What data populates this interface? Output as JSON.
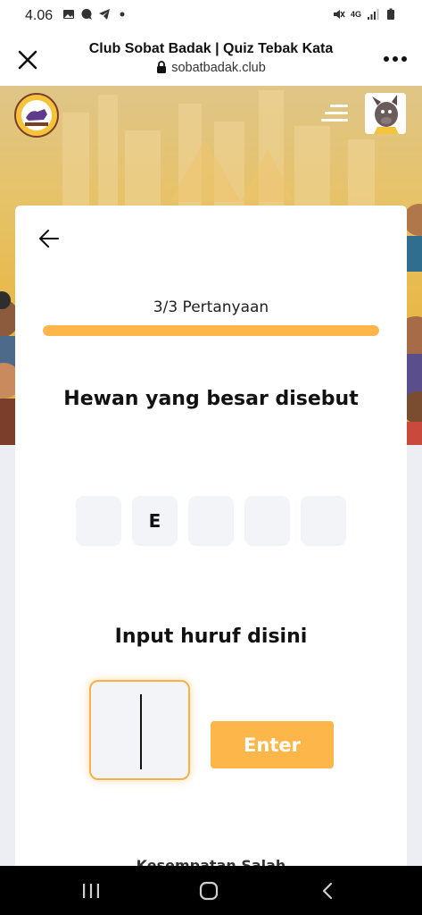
{
  "status_bar": {
    "time": "4.06",
    "network": "4G",
    "icons_left": [
      "image-icon",
      "chat-bubble-icon",
      "telegram-icon",
      "dot-icon"
    ],
    "icons_right": [
      "mute-icon",
      "network-4g-icon",
      "signal-icon",
      "battery-icon"
    ]
  },
  "browser": {
    "title": "Club Sobat Badak | Quiz Tebak Kata",
    "url": "sobatbadak.club"
  },
  "quiz": {
    "progress_label": "3/3 Pertanyaan",
    "progress_fraction": 1.0,
    "question": "Hewan yang besar disebut",
    "slots": [
      "",
      "E",
      "",
      "",
      ""
    ],
    "input_label": "Input huruf disini",
    "input_value": "",
    "enter_label": "Enter",
    "bottom_hint": "Kesempatan Salah"
  },
  "colors": {
    "accent": "#FDB64A",
    "slot_bg": "#F2F4F8",
    "nav_bg": "#000000"
  }
}
